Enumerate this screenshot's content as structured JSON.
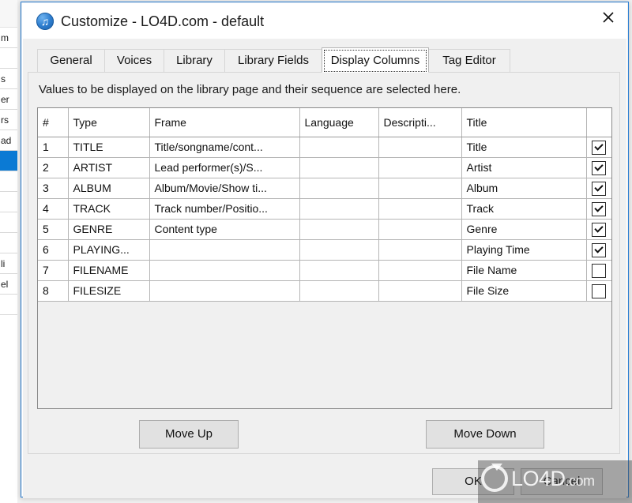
{
  "background_app": {
    "rows": [
      "m",
      "",
      "s",
      "er",
      "rs",
      "ad",
      "",
      "",
      "",
      "",
      "",
      "li",
      "el",
      ""
    ],
    "selected_index": 6
  },
  "window": {
    "title": "Customize - LO4D.com - default",
    "icon": "music-note-icon",
    "close_label": "✕"
  },
  "tabs": [
    {
      "label": "General",
      "active": false
    },
    {
      "label": "Voices",
      "active": false
    },
    {
      "label": "Library",
      "active": false
    },
    {
      "label": "Library Fields",
      "active": false
    },
    {
      "label": "Display Columns",
      "active": true
    },
    {
      "label": "Tag Editor",
      "active": false
    }
  ],
  "page": {
    "hint": "Values to be displayed on the library page and their sequence are selected here."
  },
  "grid": {
    "columns": [
      "#",
      "Type",
      "Frame",
      "Language",
      "Descripti...",
      "Title",
      ""
    ],
    "rows": [
      {
        "num": "1",
        "type": "TITLE",
        "frame": "Title/songname/cont...",
        "language": "",
        "description": "",
        "title": "Title",
        "checked": true
      },
      {
        "num": "2",
        "type": "ARTIST",
        "frame": "Lead performer(s)/S...",
        "language": "",
        "description": "",
        "title": "Artist",
        "checked": true
      },
      {
        "num": "3",
        "type": "ALBUM",
        "frame": "Album/Movie/Show ti...",
        "language": "",
        "description": "",
        "title": "Album",
        "checked": true
      },
      {
        "num": "4",
        "type": "TRACK",
        "frame": "Track number/Positio...",
        "language": "",
        "description": "",
        "title": "Track",
        "checked": true
      },
      {
        "num": "5",
        "type": "GENRE",
        "frame": "Content type",
        "language": "",
        "description": "",
        "title": "Genre",
        "checked": true
      },
      {
        "num": "6",
        "type": "PLAYING...",
        "frame": "",
        "language": "",
        "description": "",
        "title": "Playing Time",
        "checked": true
      },
      {
        "num": "7",
        "type": "FILENAME",
        "frame": "",
        "language": "",
        "description": "",
        "title": "File Name",
        "checked": false
      },
      {
        "num": "8",
        "type": "FILESIZE",
        "frame": "",
        "language": "",
        "description": "",
        "title": "File Size",
        "checked": false
      }
    ]
  },
  "actions": {
    "move_up": "Move Up",
    "move_down": "Move Down"
  },
  "footer": {
    "ok": "OK",
    "cancel": "Cancel"
  },
  "watermark": {
    "text": "LO4D",
    "domain": ".com"
  },
  "colors": {
    "window_border": "#2a7fd4",
    "dialog_bg": "#f0f0f0",
    "grid_bg": "#ffffff",
    "selection": "#0b7ad4"
  }
}
